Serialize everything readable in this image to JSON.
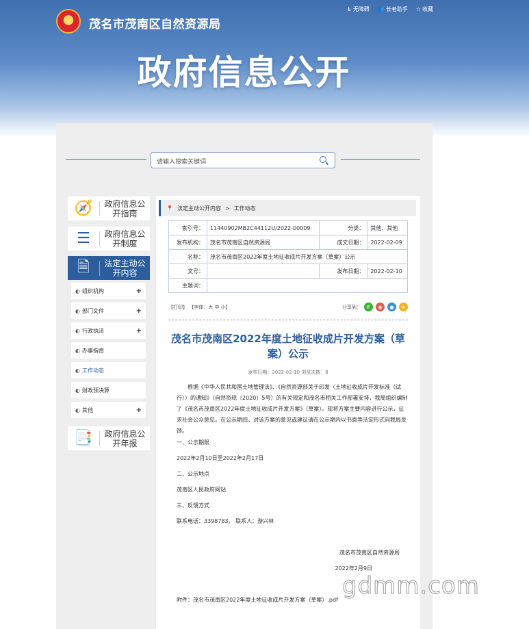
{
  "header": {
    "site_title": "茂名市茂南区自然资源局",
    "links": [
      {
        "icon": "accessibility-icon",
        "label": "无障碍"
      },
      {
        "icon": "elder-helper-icon",
        "label": "长者助手"
      },
      {
        "icon": "star-icon",
        "label": "收藏"
      }
    ],
    "banner_title": "政府信息公开"
  },
  "search": {
    "placeholder": "请输入搜索关键词"
  },
  "sidebar": {
    "big_items": [
      {
        "icon": "compass-icon",
        "label": "政府信息公开指南"
      },
      {
        "icon": "document-list-icon",
        "label": "政府信息公开制度"
      },
      {
        "icon": "document-icon",
        "label": "法定主动公开内容"
      },
      {
        "icon": "annual-report-icon",
        "label": "政府信息公开年报"
      }
    ],
    "sub_items": [
      {
        "label": "组织机构",
        "plus": "+"
      },
      {
        "label": "部门文件",
        "plus": "+"
      },
      {
        "label": "行政执法",
        "plus": "+"
      },
      {
        "label": "办事指南",
        "plus": ""
      },
      {
        "label": "工作动态",
        "plus": ""
      },
      {
        "label": "财政预决算",
        "plus": ""
      },
      {
        "label": "其他",
        "plus": "+"
      }
    ]
  },
  "breadcrumb": {
    "level1": "法定主动公开内容",
    "separator": ">",
    "level2": "工作动态"
  },
  "meta": {
    "index_label": "索引号：",
    "index_value": "11440902MB2C44112U/2022-00009",
    "category_label": "分类：",
    "category_value": "其他、其他",
    "publisher_label": "发布机构：",
    "publisher_value": "茂名市茂南区自然资源局",
    "created_label": "成文日期：",
    "created_value": "2022-02-09",
    "name_label": "名称：",
    "name_value": "茂名市茂南区2022年度土地征收成片开发方案（草案）公示",
    "docno_label": "文号：",
    "docno_value": "",
    "published_label": "发布日期：",
    "published_value": "2022-02-10",
    "subject_label": "主题词：",
    "subject_value": ""
  },
  "tools": {
    "left": "【打印】 【字体：大  中  小】",
    "share_label": "分享到："
  },
  "article": {
    "title": "茂名市茂南区2022年度土地征收成片开发方案（草案）公示",
    "info": "发布日期：2022-02-10  浏览次数：8",
    "intro": "根据《中华人民共和国土地管理法》、《自然资源部关于印发〈土地征收成片开发标准（试行）〉的通知》（自然资规〔2020〕5号）的有关规定和茂名市相关工作部署安排，我局组织编制了《茂名市茂南区2022年度土地征收成片开发方案》（草案）。现将方案主要内容进行公示，征求社会公众意见。在公示期间，对该方案的意见或建议请在公示期内以书面等法定形式向我局反馈。",
    "s1_title": "一、公示期限",
    "s1_body": "2022年2月10日至2022年2月17日",
    "s2_title": "二、公示地点",
    "s2_body": "茂南区人民政府网站",
    "s3_title": "三、反馈方式",
    "s3_body": "联系电话：3398783，  联系人：游兴林",
    "sign_org": "茂名市茂南区自然资源局",
    "sign_date": "2022年2月9日",
    "attachment": "附件：茂名市茂南区2022年度土地征收成片开发方案（草案）.pdf"
  },
  "watermark": "gdmm.com"
}
